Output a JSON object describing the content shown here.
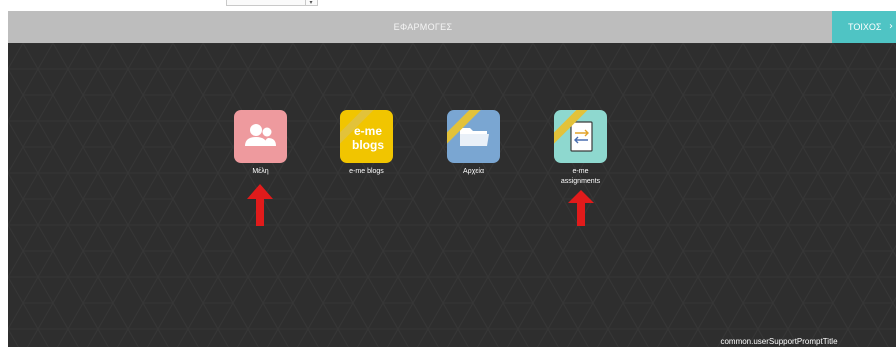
{
  "header": {
    "title": "ΕΦΑΡΜΟΓΕΣ"
  },
  "wall_tab": {
    "label": "ΤΟΙΧΟΣ",
    "chevron": "›"
  },
  "apps": [
    {
      "label": "Μέλη",
      "icon": "members-icon",
      "color": "#ee9a9e"
    },
    {
      "label": "e-me blogs",
      "icon": "blogs-icon",
      "color": "#f1c500",
      "tile_text": "e-me\nblogs"
    },
    {
      "label": "Αρχεία",
      "icon": "folder-icon",
      "color": "#7aa6d2"
    },
    {
      "label": "e-me\nassignments",
      "icon": "assignments-icon",
      "color": "#8ed8cf"
    }
  ],
  "support_prompt": "common.userSupportPromptTitle",
  "colors": {
    "accent": "#4fc4c4",
    "arrow": "#e11b1b",
    "stage": "#2e2e2e",
    "header": "#bdbdbd"
  }
}
